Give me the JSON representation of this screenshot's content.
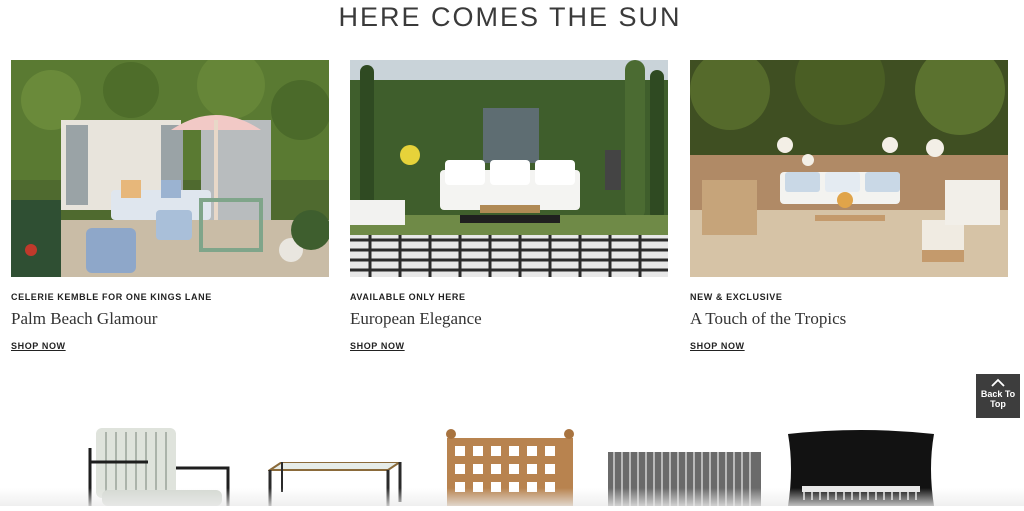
{
  "section": {
    "title": "HERE COMES THE SUN"
  },
  "cards": [
    {
      "eyebrow": "CELERIE KEMBLE FOR ONE KINGS LANE",
      "name": "Palm Beach Glamour",
      "cta": "SHOP NOW"
    },
    {
      "eyebrow": "AVAILABLE ONLY HERE",
      "name": "European Elegance",
      "cta": "SHOP NOW"
    },
    {
      "eyebrow": "NEW & EXCLUSIVE",
      "name": "A Touch of the Tropics",
      "cta": "SHOP NOW"
    }
  ],
  "back_to_top": {
    "line1": "Back To",
    "line2": "Top",
    "icon": "chevron-up-icon"
  },
  "products": [
    "striped-lounge-chair",
    "glass-side-table",
    "teak-lattice-planter",
    "striped-outdoor-rug",
    "black-fringe-pillow"
  ]
}
